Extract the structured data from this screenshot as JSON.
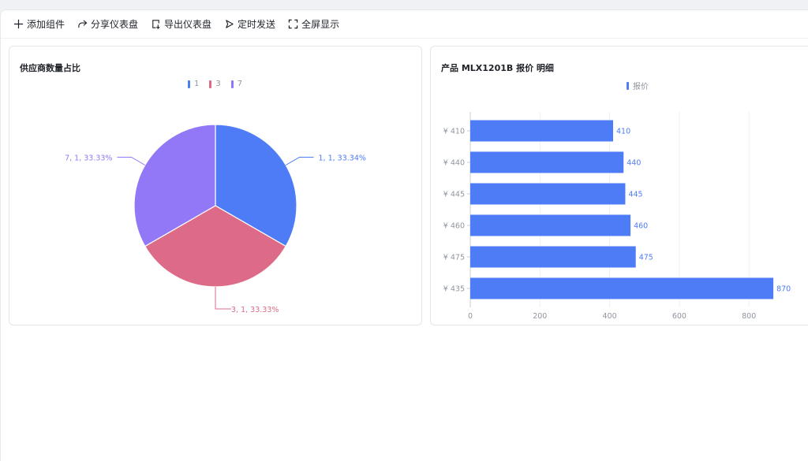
{
  "toolbar": {
    "add_label": "添加组件",
    "share_label": "分享仪表盘",
    "export_label": "导出仪表盘",
    "schedule_label": "定时发送",
    "fullscreen_label": "全屏显示"
  },
  "colors": {
    "blue": "#4e7bf6",
    "red": "#dd6b88",
    "purple": "#9278f7"
  },
  "pie_card": {
    "title": "供应商数量占比"
  },
  "bar_card": {
    "title": "产品 MLX1201B 报价 明细"
  },
  "chart_data": [
    {
      "type": "pie",
      "title": "供应商数量占比",
      "legend": [
        "1",
        "3",
        "7"
      ],
      "legend_position": "top",
      "slices": [
        {
          "name": "1",
          "value": 1,
          "percent": "33.34%",
          "label": "1, 1, 33.34%"
        },
        {
          "name": "3",
          "value": 1,
          "percent": "33.33%",
          "label": "3, 1, 33.33%"
        },
        {
          "name": "7",
          "value": 1,
          "percent": "33.33%",
          "label": "7, 1, 33.33%"
        }
      ]
    },
    {
      "type": "bar",
      "orientation": "horizontal",
      "title": "产品 MLX1201B 报价 明细",
      "legend": [
        "报价"
      ],
      "legend_position": "top",
      "categories": [
        "¥ 410",
        "¥ 440",
        "¥ 445",
        "¥ 460",
        "¥ 475",
        "¥ 435"
      ],
      "series": [
        {
          "name": "报价",
          "values": [
            410,
            440,
            445,
            460,
            475,
            870
          ]
        }
      ],
      "xlim": [
        0,
        940
      ],
      "xticks": [
        "0",
        "200",
        "400",
        "600",
        "800"
      ],
      "grid": true
    }
  ]
}
